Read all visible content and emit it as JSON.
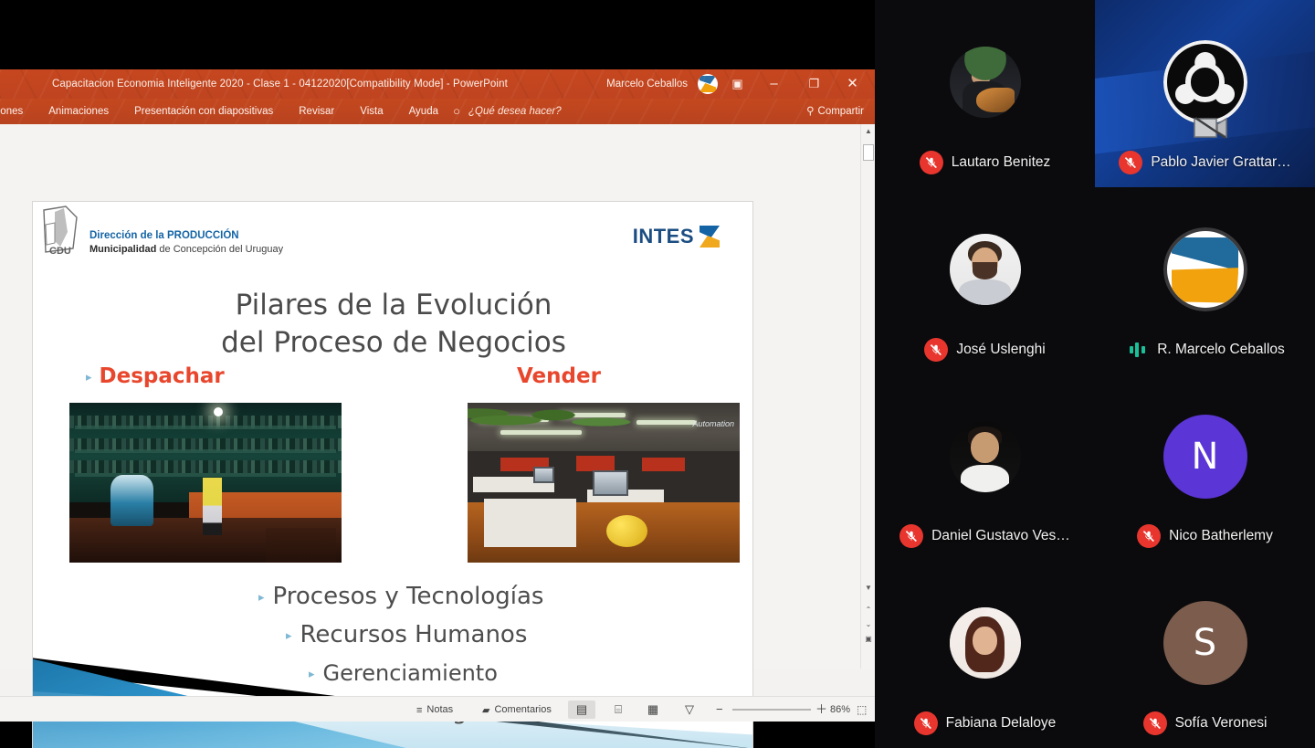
{
  "powerpoint": {
    "title": "Capacitacion Economia Inteligente 2020 -  Clase 1 - 04122020[Compatibility Mode]  -  PowerPoint",
    "account_name": "Marcelo Ceballos",
    "window_controls": {
      "ribbon_display_options": "▣",
      "minimize": "–",
      "restore": "❐",
      "close": "✕"
    },
    "ribbon_tabs": [
      "ciones",
      "Animaciones",
      "Presentación con diapositivas",
      "Revisar",
      "Vista",
      "Ayuda"
    ],
    "tell_me_placeholder": "¿Qué desea hacer?",
    "tell_me_icon": "○",
    "share_label": "Compartir",
    "share_icon": "⚲",
    "status_bar": {
      "notes_label": "Notas",
      "notes_icon": "≡",
      "comments_label": "Comentarios",
      "comments_icon": "▰",
      "view_normal_icon": "▤",
      "view_sorter_icon": "⌸",
      "view_reading_icon": "▦",
      "view_slideshow_icon": "▽",
      "zoom_out_icon": "−",
      "zoom_in_icon": "＋",
      "zoom_value": "86%",
      "fit_slide_icon": "⬚"
    },
    "scrollbar": {
      "up_arrow": "▲",
      "down_arrow": "▼",
      "prev_slide": "⌃",
      "next_slide": "⌄",
      "select_slide": "▣"
    }
  },
  "slide": {
    "org_line1": "Dirección de la PRODUCCIÓN",
    "org_line2_bold": "Municipalidad",
    "org_line2_rest": " de Concepción del Uruguay",
    "org_logo_text": "CDU",
    "brand": "INTES",
    "title_line1": "Pilares de la Evolución",
    "title_line2": "del Proceso de Negocios",
    "column_headers": [
      {
        "label": "Despachar",
        "bullet": "▸"
      },
      {
        "label": "Vender",
        "bullet": ""
      }
    ],
    "bullets": [
      {
        "bullet": "▸",
        "label": "Procesos y Tecnologías"
      },
      {
        "bullet": "▸",
        "label": "Recursos Humanos"
      },
      {
        "bullet": "▸",
        "label": "Gerenciamiento"
      },
      {
        "bullet": "▸",
        "label": "Modelo de Negocios"
      }
    ],
    "photo_left_alt": "almacen-tradicional-photo",
    "photo_right_alt": "oficina-moderna-photo"
  },
  "zoom_meeting": {
    "participants": [
      {
        "name": "Lautaro Benitez",
        "muted": true,
        "active_speaker": false,
        "avatar_type": "photo",
        "avatar_class": "ph-guitar",
        "initial": ""
      },
      {
        "name": "Pablo Javier Grattar…",
        "muted": true,
        "active_speaker": true,
        "avatar_type": "obs",
        "avatar_class": "",
        "initial": ""
      },
      {
        "name": "José Uslenghi",
        "muted": true,
        "active_speaker": false,
        "avatar_type": "photo",
        "avatar_class": "ph-jose",
        "initial": ""
      },
      {
        "name": "R. Marcelo Ceballos",
        "muted": false,
        "active_speaker": false,
        "avatar_type": "intes",
        "avatar_class": "",
        "initial": ""
      },
      {
        "name": "Daniel Gustavo Ves…",
        "muted": true,
        "active_speaker": false,
        "avatar_type": "photo",
        "avatar_class": "ph-daniel",
        "initial": ""
      },
      {
        "name": "Nico Batherlemy",
        "muted": true,
        "active_speaker": false,
        "avatar_type": "initial",
        "avatar_class": "",
        "initial": "N",
        "avatar_color": "#5b35d5"
      },
      {
        "name": "Fabiana Delaloye",
        "muted": true,
        "active_speaker": false,
        "avatar_type": "photo",
        "avatar_class": "ph-fab",
        "initial": ""
      },
      {
        "name": "Sofía Veronesi",
        "muted": true,
        "active_speaker": false,
        "avatar_type": "initial",
        "avatar_class": "",
        "initial": "S",
        "avatar_color": "#7b5c4d"
      }
    ]
  },
  "colors": {
    "powerpoint_orange": "#c6471f",
    "slide_accent_red": "#e8472d",
    "slide_bullet_blue": "#7fb8d4",
    "brand_blue": "#1464a5",
    "brand_orange": "#f0a81e",
    "mic_muted_red": "#e8362e",
    "audio_green": "#19c09a",
    "active_tile_blue": "#133f96"
  }
}
